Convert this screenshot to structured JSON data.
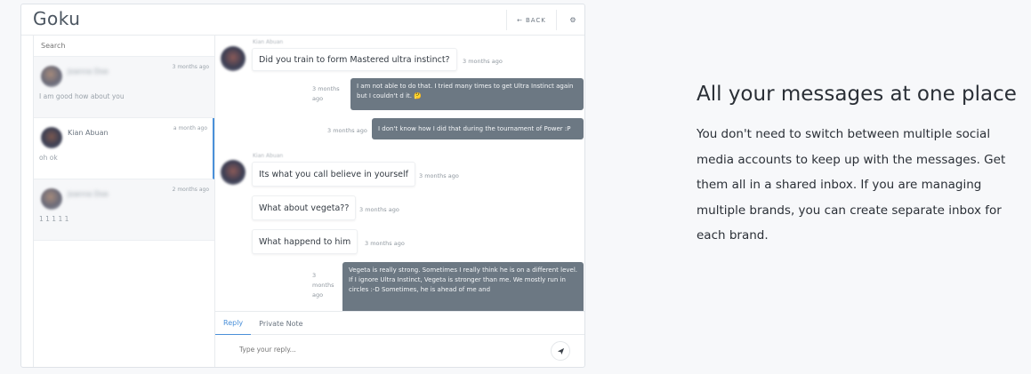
{
  "app": {
    "title": "Goku",
    "back_label": "BACK"
  },
  "sidebar": {
    "search_placeholder": "Search",
    "conversations": [
      {
        "name": "Joanna Doe",
        "time": "3 months ago",
        "preview": "I am good how about you"
      },
      {
        "name": "Kian Abuan",
        "time": "a month ago",
        "preview": "oh ok"
      },
      {
        "name": "Joanna Doe",
        "time": "2 months ago",
        "preview": "1 1 1 1 1"
      }
    ]
  },
  "chat": {
    "messages": [
      {
        "sender": "Kian Abuan",
        "text": "Did you train to form Mastered ultra instinct?",
        "time": "3 months ago"
      },
      {
        "text": "I am not able to do that. I tried many times to get Ultra Instinct again but I couldn't d it. 🤔",
        "time": "3 months ago"
      },
      {
        "text": "I don't know how I did that during the tournament of Power :P",
        "time": "3 months ago"
      },
      {
        "sender": "Kian Abuan",
        "text": "Its what you call believe in yourself",
        "time": "3 months ago"
      },
      {
        "text": "What about vegeta??",
        "time": "3 months ago"
      },
      {
        "text": "What happend to him",
        "time": "3 months ago"
      },
      {
        "text": "Vegeta is really strong. Sometimes I really think he is on a different level. If I ignore Ultra Instinct, Vegeta is stronger than me. We mostly run in circles :-D Sometimes, he is ahead of me and",
        "time": "3 months ago"
      }
    ]
  },
  "composer": {
    "tabs": [
      "Reply",
      "Private Note"
    ],
    "placeholder": "Type your reply..."
  },
  "promo": {
    "title": "All your messages at one place",
    "body": "You don't need to switch between multiple social media accounts to keep up with the messages. Get them all in a shared inbox. If you are managing multiple brands, you can create separate inbox for each brand."
  }
}
